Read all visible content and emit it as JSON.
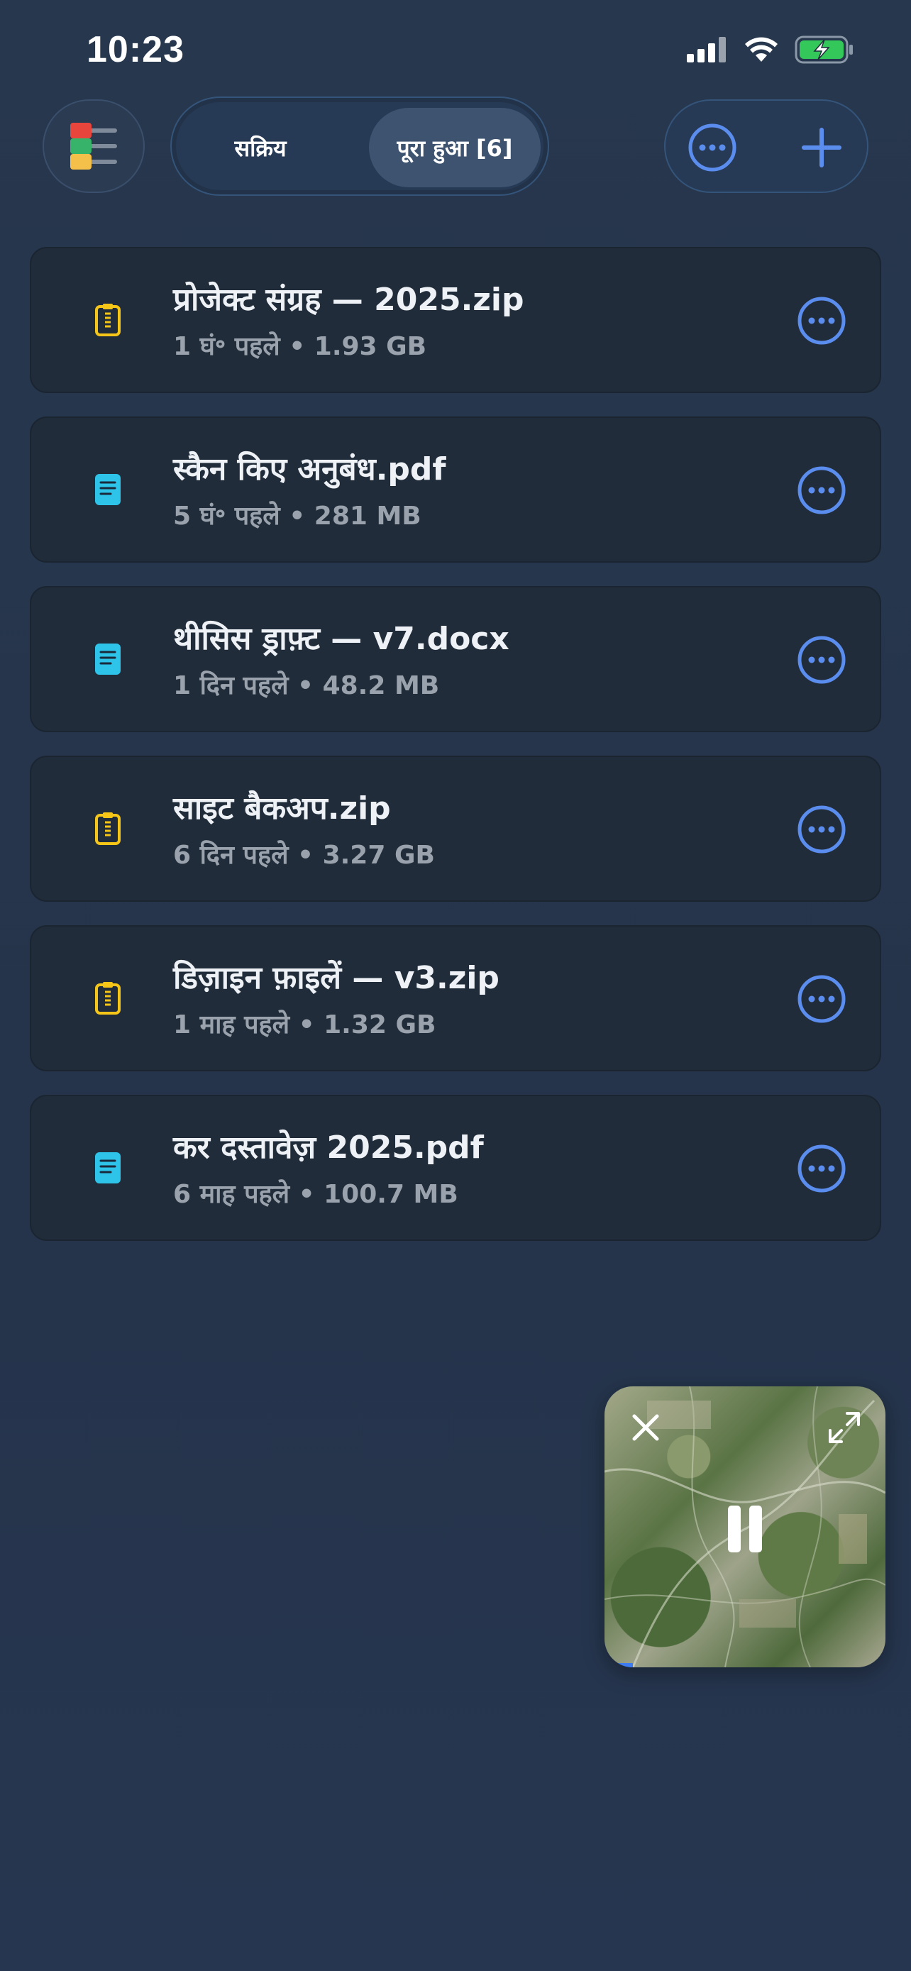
{
  "status_bar": {
    "time": "10:23",
    "battery_color": "#34c759"
  },
  "header": {
    "menu_icon": "list-color-icon",
    "tabs": [
      {
        "label": "सक्रिय",
        "selected": false
      },
      {
        "label": "पूरा हुआ [6]",
        "selected": true
      }
    ],
    "actions": [
      {
        "icon": "more-circle-icon"
      },
      {
        "icon": "plus-icon"
      }
    ],
    "accent_color": "#5b8def"
  },
  "files": [
    {
      "name": "प्रोजेक्ट संग्रह — 2025.zip",
      "meta": "1 घं॰ पहले • 1.93 GB",
      "icon": "zip-file-icon"
    },
    {
      "name": "स्कैन किए अनुबंध.pdf",
      "meta": "5 घं॰ पहले • 281 MB",
      "icon": "document-icon"
    },
    {
      "name": "थीसिस ड्राफ़्ट — v7.docx",
      "meta": "1 दिन पहले • 48.2 MB",
      "icon": "document-icon"
    },
    {
      "name": "साइट बैकअप.zip",
      "meta": "6 दिन पहले • 3.27 GB",
      "icon": "zip-file-icon"
    },
    {
      "name": "डिज़ाइन फ़ाइलें — v3.zip",
      "meta": "1 माह पहले • 1.32 GB",
      "icon": "zip-file-icon"
    },
    {
      "name": "कर दस्तावेज़ 2025.pdf",
      "meta": "6 माह पहले • 100.7 MB",
      "icon": "document-icon"
    }
  ],
  "mini_player": {
    "state": "playing",
    "progress_fraction": 0.1
  }
}
